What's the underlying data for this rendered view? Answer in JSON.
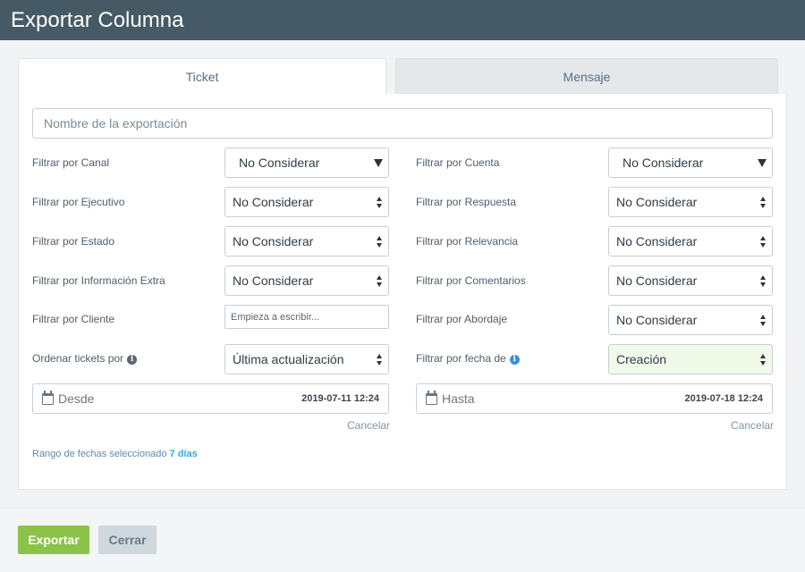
{
  "window": {
    "title": "Exportar Columna"
  },
  "tabs": [
    {
      "label": "Ticket",
      "active": true
    },
    {
      "label": "Mensaje",
      "active": false
    }
  ],
  "export_name": {
    "placeholder": "Nombre de la exportación",
    "value": ""
  },
  "filters_left": [
    {
      "label": "Filtrar por Canal",
      "value": "No Considerar",
      "arrow": "triangle"
    },
    {
      "label": "Filtrar por Ejecutivo",
      "value": "No Considerar",
      "arrow": "updown"
    },
    {
      "label": "Filtrar por Estado",
      "value": "No Considerar",
      "arrow": "updown"
    },
    {
      "label": "Filtrar por Información Extra",
      "value": "No Considerar",
      "arrow": "updown"
    }
  ],
  "filters_right": [
    {
      "label": "Filtrar por Cuenta",
      "value": "No Considerar",
      "arrow": "triangle"
    },
    {
      "label": "Filtrar por Respuesta",
      "value": "No Considerar",
      "arrow": "updown"
    },
    {
      "label": "Filtrar por Relevancia",
      "value": "No Considerar",
      "arrow": "updown"
    },
    {
      "label": "Filtrar por Comentarios",
      "value": "No Considerar",
      "arrow": "updown"
    },
    {
      "label": "Filtrar por Abordaje",
      "value": "No Considerar",
      "arrow": "updown"
    }
  ],
  "client_filter": {
    "label": "Filtrar por Cliente",
    "placeholder": "Empieza a escribir..."
  },
  "order": {
    "label": "Ordenar tickets por",
    "value": "Última actualización",
    "info_icon": "info-icon"
  },
  "date_type": {
    "label": "Filtrar por fecha de",
    "value": "Creación",
    "info_icon": "info-icon",
    "highlight_color": "#f1f9e9"
  },
  "date_from": {
    "label": "Desde",
    "value": "2019-07-11 12:24",
    "cancel": "Cancelar",
    "icon": "calendar-icon"
  },
  "date_to": {
    "label": "Hasta",
    "value": "2019-07-18 12:24",
    "cancel": "Cancelar",
    "icon": "calendar-icon"
  },
  "range": {
    "prefix": "Rango de fechas seleccionado",
    "value": "7 días"
  },
  "footer": {
    "export_label": "Exportar",
    "close_label": "Cerrar"
  },
  "colors": {
    "header": "#455a64",
    "export_button": "#8bc34a",
    "close_button": "#cfd8dc",
    "range_accent": "#2fa9e0"
  }
}
